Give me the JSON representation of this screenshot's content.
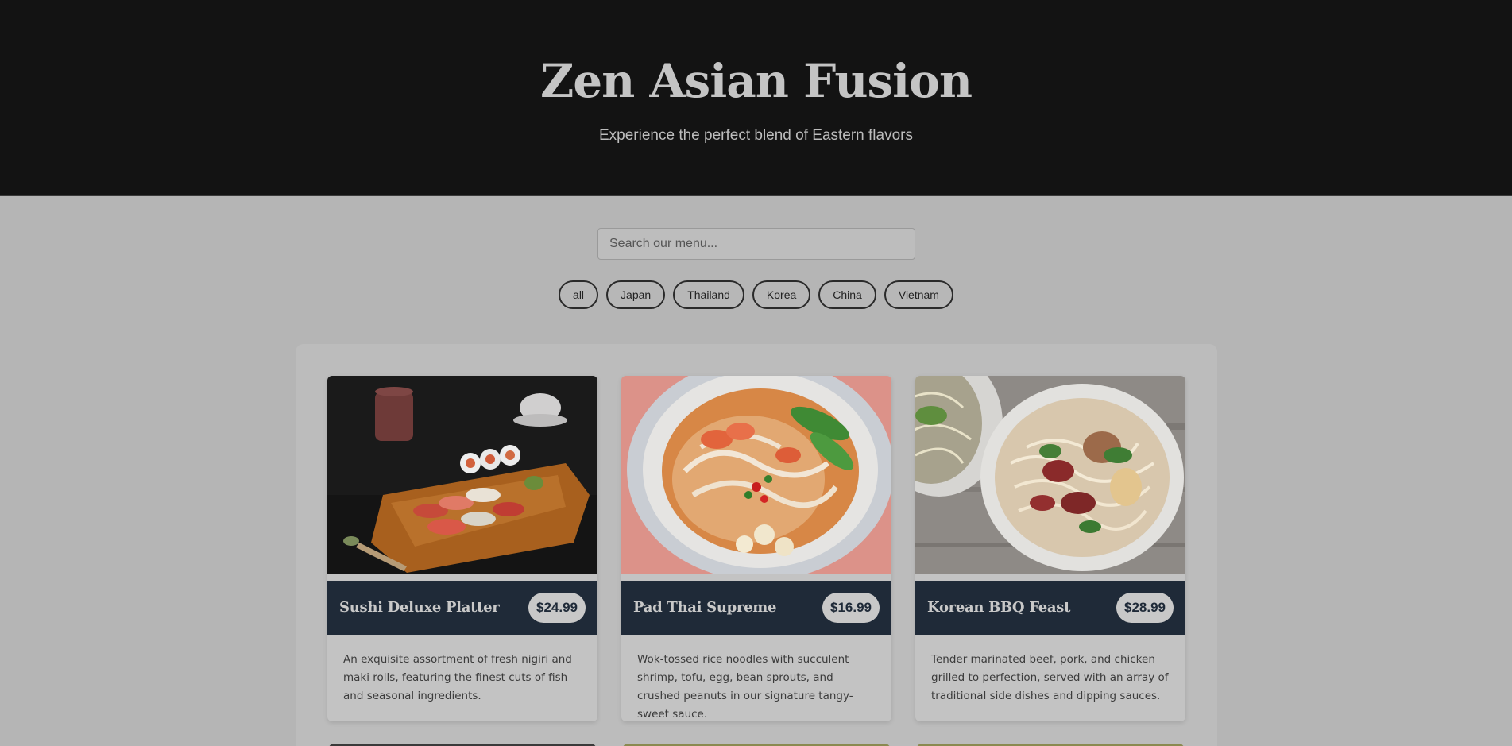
{
  "hero": {
    "title": "Zen Asian Fusion",
    "subtitle": "Experience the perfect blend of Eastern flavors"
  },
  "search": {
    "placeholder": "Search our menu..."
  },
  "filters": [
    "all",
    "Japan",
    "Thailand",
    "Korea",
    "China",
    "Vietnam"
  ],
  "menu": [
    {
      "title": "Sushi Deluxe Platter",
      "price": "$24.99",
      "description": "An exquisite assortment of fresh nigiri and maki rolls, featuring the finest cuts of fish and seasonal ingredients.",
      "image": "sushi-platter-photo"
    },
    {
      "title": "Pad Thai Supreme",
      "price": "$16.99",
      "description": "Wok-tossed rice noodles with succulent shrimp, tofu, egg, bean sprouts, and crushed peanuts in our signature tangy-sweet sauce.",
      "image": "noodle-soup-photo"
    },
    {
      "title": "Korean BBQ Feast",
      "price": "$28.99",
      "description": "Tender marinated beef, pork, and chicken grilled to perfection, served with an array of traditional side dishes and dipping sauces.",
      "image": "beef-noodle-bowl-photo"
    }
  ],
  "colors": {
    "hero_bg": "#131313",
    "page_bg": "#b5b5b5",
    "card_header": "#1f2a38",
    "price_badge": "#c8c8c8"
  }
}
